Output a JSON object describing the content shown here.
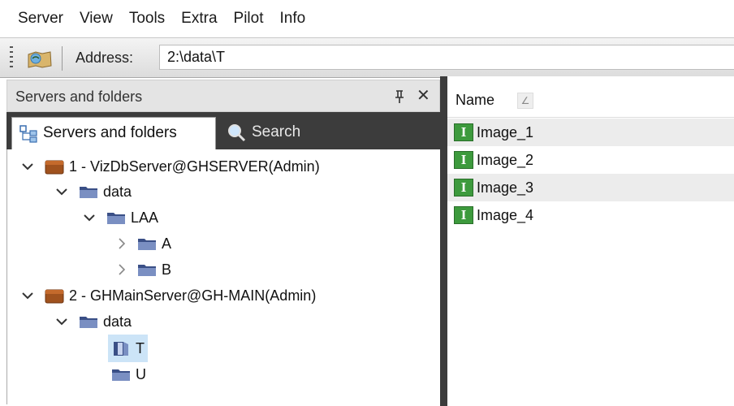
{
  "menu": [
    "Server",
    "View",
    "Tools",
    "Extra",
    "Pilot",
    "Info"
  ],
  "toolbar": {
    "address_label": "Address:",
    "address_value": "2:\\data\\T"
  },
  "left_pane": {
    "title": "Servers and folders",
    "pin_glyph": "⊣",
    "close_glyph": "✕",
    "tabs": [
      {
        "label": "Servers and folders",
        "icon": "folder-tree-icon",
        "active": true
      },
      {
        "label": "Search",
        "icon": "search-icon",
        "active": false
      }
    ],
    "tree": [
      {
        "label": "1 - VizDbServer@GHSERVER(Admin)",
        "type": "server",
        "level": 0,
        "expanded": true
      },
      {
        "label": "data",
        "type": "folder",
        "level": 1,
        "expanded": true
      },
      {
        "label": "LAA",
        "type": "folder",
        "level": 2,
        "expanded": true
      },
      {
        "label": "A",
        "type": "folder",
        "level": 3,
        "expanded": false
      },
      {
        "label": "B",
        "type": "folder",
        "level": 3,
        "expanded": false
      },
      {
        "label": "2 - GHMainServer@GH-MAIN(Admin)",
        "type": "server",
        "level": 0,
        "expanded": true
      },
      {
        "label": "data",
        "type": "folder",
        "level": 1,
        "expanded": true
      },
      {
        "label": "T",
        "type": "folder-open",
        "level": 2,
        "selected": true
      },
      {
        "label": "U",
        "type": "folder",
        "level": 2
      }
    ]
  },
  "right_pane": {
    "column_header": "Name",
    "sort_glyph": "∠",
    "items": [
      "Image_1",
      "Image_2",
      "Image_3",
      "Image_4"
    ],
    "item_icon_letter": "I"
  },
  "colors": {
    "selection": "#cce4f7",
    "dark_strip": "#3c3c3c",
    "server_icon": "#a0521e",
    "folder_icon": "#3a4f86",
    "image_icon": "#3d9a3d"
  }
}
